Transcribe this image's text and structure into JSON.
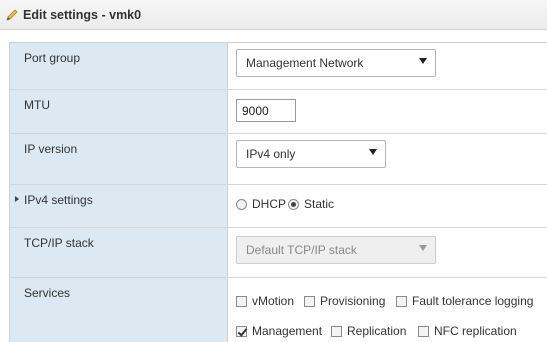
{
  "dialog": {
    "title": "Edit settings - vmk0",
    "icon": "pencil-icon"
  },
  "port_group": {
    "label": "Port group",
    "value": "Management Network"
  },
  "mtu": {
    "label": "MTU",
    "value": "9000"
  },
  "ip_version": {
    "label": "IP version",
    "value": "IPv4 only"
  },
  "ipv4_settings": {
    "label": "IPv4 settings",
    "dhcp_label": "DHCP",
    "static_label": "Static",
    "selected": "Static"
  },
  "tcpip_stack": {
    "label": "TCP/IP stack",
    "value": "Default TCP/IP stack",
    "disabled": true
  },
  "services": {
    "label": "Services",
    "options": [
      {
        "label": "vMotion",
        "checked": false
      },
      {
        "label": "Provisioning",
        "checked": false
      },
      {
        "label": "Fault tolerance logging",
        "checked": false
      },
      {
        "label": "Management",
        "checked": true
      },
      {
        "label": "Replication",
        "checked": false
      },
      {
        "label": "NFC replication",
        "checked": false
      }
    ]
  }
}
